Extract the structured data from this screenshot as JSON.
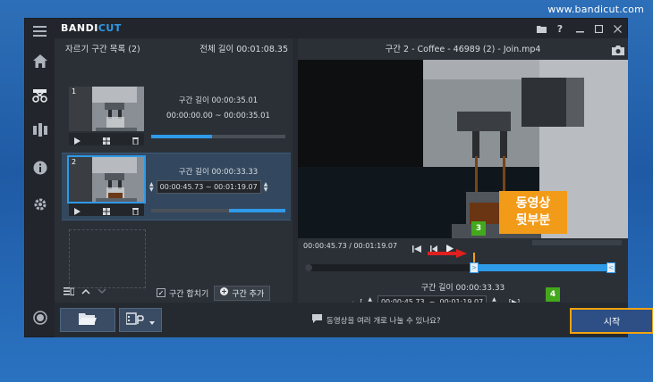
{
  "watermark": {
    "url": "www.bandicut.com"
  },
  "app": {
    "brand_main": "BANDI",
    "brand_accent": "CUT",
    "accent_color": "#2f9ae8",
    "titlebar_buttons": [
      "folder-icon",
      "help-icon",
      "minimize-icon",
      "maximize-icon",
      "close-icon"
    ],
    "rail_icons": [
      "menu-icon",
      "home-icon",
      "cut-icon",
      "merge-icon",
      "info-icon",
      "settings-icon",
      "record-icon"
    ]
  },
  "segments_panel": {
    "title": "자르기 구간 목록 (2)",
    "total_length": "전체 길이 00:01:08.35",
    "items": [
      {
        "index": "1",
        "length_label": "구간 길이 00:00:35.01",
        "range": "00:00:00.00 ~ 00:00:35.01",
        "progress": 0.45
      },
      {
        "index": "2",
        "length_label": "구간 길이 00:00:33.33",
        "start": "00:00:45.73",
        "separator": "~",
        "end": "00:01:19.07",
        "progress_start": 0.58,
        "progress": 1.0
      }
    ],
    "merge_label": "구간 합치기",
    "merge_checked": true,
    "add_label": "구간 추가"
  },
  "preview": {
    "file_title": "구간 2 - Coffee - 46989 (2) - Join.mp4",
    "time_readout": "00:00:45.73 / 00:01:19.07",
    "segment_length": "구간 길이 00:00:33.33",
    "start_time": "00:00:45.73",
    "separator": "~",
    "end_time": "00:01:19.07",
    "range_start_fraction": 0.55,
    "range_end_fraction": 1.0
  },
  "bottom_bar": {
    "hint": "동영상을 여러 개로 나눌 수 있나요?",
    "start_label": "시작"
  },
  "annotations": {
    "callout_line1": "동영상",
    "callout_line2": "뒷부분",
    "badge3": "3",
    "badge4": "4",
    "callout_color": "#f29b19",
    "badge_color": "#43a81c",
    "highlight_color": "#f3a30e"
  }
}
